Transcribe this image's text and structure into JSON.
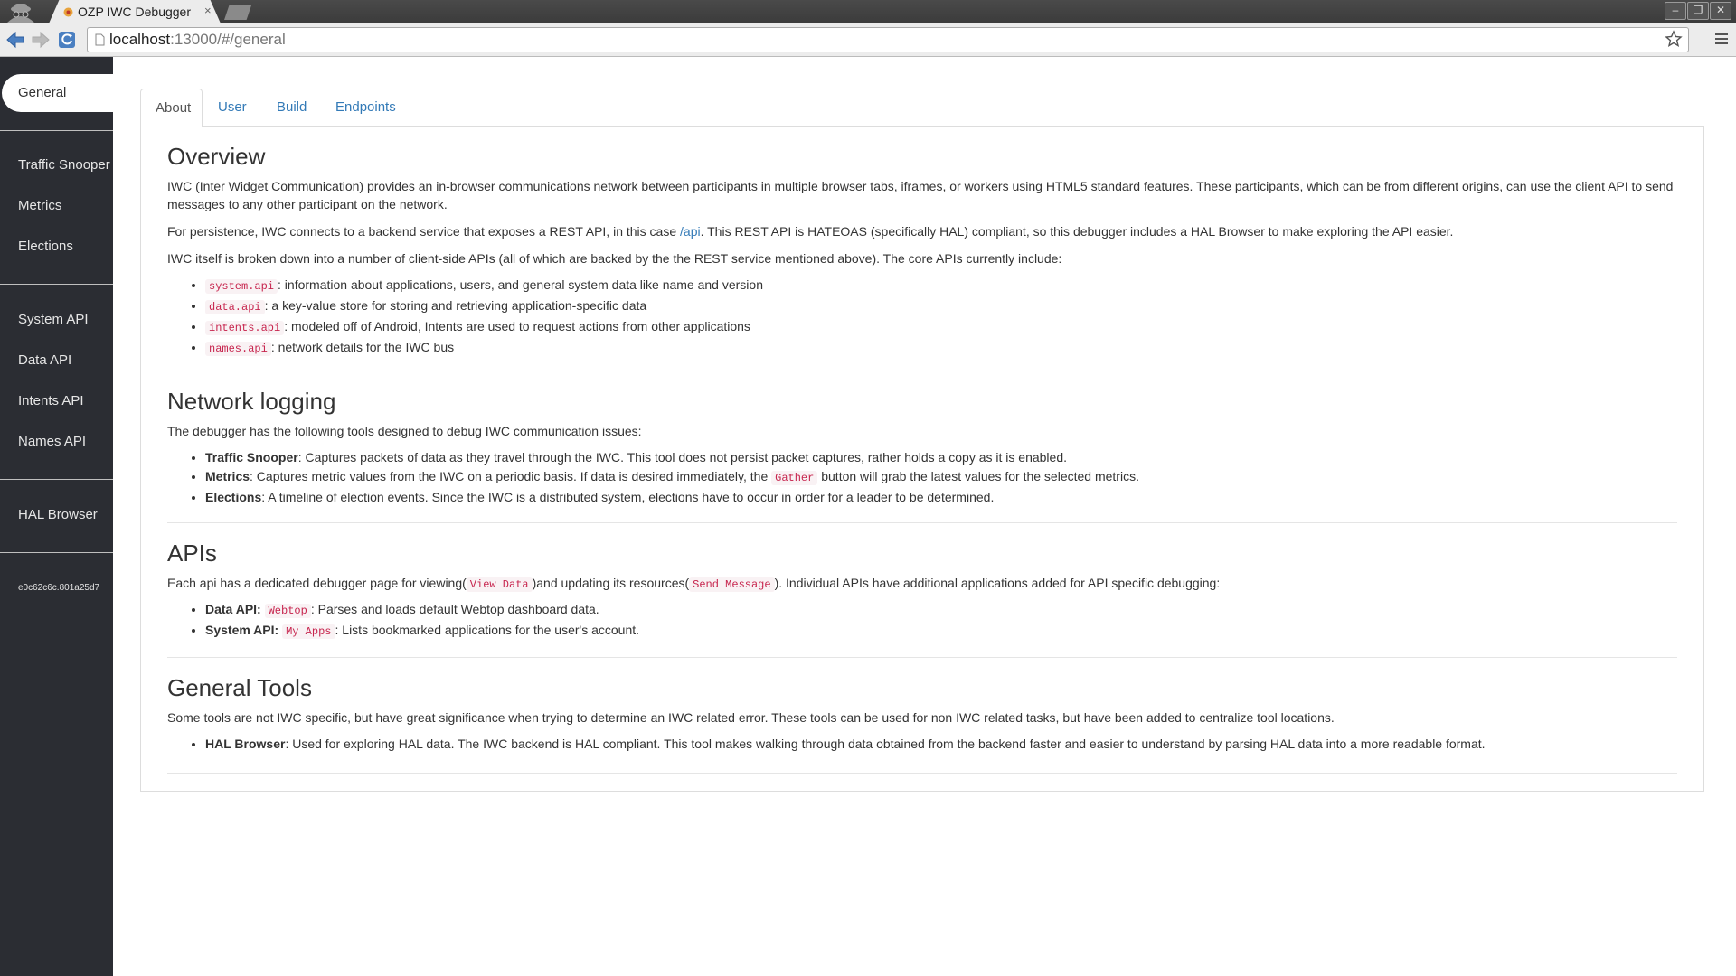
{
  "browser": {
    "tab_title": "OZP IWC Debugger",
    "tab_close": "×",
    "url_host": "localhost",
    "url_rest": ":13000/#/general",
    "window_buttons": [
      "–",
      "❐",
      "✕"
    ]
  },
  "sidebar": {
    "active": "General",
    "group1": [
      "Traffic Snooper",
      "Metrics",
      "Elections"
    ],
    "group2": [
      "System API",
      "Data API",
      "Intents API",
      "Names API"
    ],
    "group3": [
      "HAL Browser"
    ],
    "hash": "e0c62c6c.801a25d7"
  },
  "tabs": [
    "About",
    "User",
    "Build",
    "Endpoints"
  ],
  "overview": {
    "title": "Overview",
    "p1": "IWC (Inter Widget Communication) provides an in-browser communications network between participants in multiple browser tabs, iframes, or workers using HTML5 standard features. These participants, which can be from different origins, can use the client API to send messages to any other participant on the network.",
    "p2_before": "For persistence, IWC connects to a backend service that exposes a REST API, in this case ",
    "p2_link": "/api",
    "p2_after": ". This REST API is HATEOAS (specifically HAL) compliant, so this debugger includes a HAL Browser to make exploring the API easier.",
    "p3": "IWC itself is broken down into a number of client-side APIs (all of which are backed by the the REST service mentioned above). The core APIs currently include:",
    "apis": [
      {
        "code": "system.api",
        "text": ": information about applications, users, and general system data like name and version"
      },
      {
        "code": "data.api",
        "text": ": a key-value store for storing and retrieving application-specific data"
      },
      {
        "code": "intents.api",
        "text": ": modeled off of Android, Intents are used to request actions from other applications"
      },
      {
        "code": "names.api",
        "text": ": network details for the IWC bus"
      }
    ]
  },
  "network": {
    "title": "Network logging",
    "intro": "The debugger has the following tools designed to debug IWC communication issues:",
    "traffic_label": "Traffic Snooper",
    "traffic_text": ": Captures packets of data as they travel through the IWC. This tool does not persist packet captures, rather holds a copy as it is enabled.",
    "metrics_label": "Metrics",
    "metrics_before": ": Captures metric values from the IWC on a periodic basis. If data is desired immediately, the ",
    "metrics_code": "Gather",
    "metrics_after": " button will grab the latest values for the selected metrics.",
    "elections_label": "Elections",
    "elections_text": ": A timeline of election events. Since the IWC is a distributed system, elections have to occur in order for a leader to be determined."
  },
  "apis": {
    "title": "APIs",
    "p_before": "Each api has a dedicated debugger page for viewing(",
    "p_code1": "View Data",
    "p_mid": ")and updating its resources(",
    "p_code2": "Send Message",
    "p_after": "). Individual APIs have additional applications added for API specific debugging:",
    "data_label": "Data API:",
    "data_code": "Webtop",
    "data_text": ": Parses and loads default Webtop dashboard data.",
    "system_label": "System API:",
    "system_code": "My Apps",
    "system_text": ": Lists bookmarked applications for the user's account."
  },
  "tools": {
    "title": "General Tools",
    "p": "Some tools are not IWC specific, but have great significance when trying to determine an IWC related error. These tools can be used for non IWC related tasks, but have been added to centralize tool locations.",
    "hal_label": "HAL Browser",
    "hal_text": ": Used for exploring HAL data. The IWC backend is HAL compliant. This tool makes walking through data obtained from the backend faster and easier to understand by parsing HAL data into a more readable format."
  }
}
